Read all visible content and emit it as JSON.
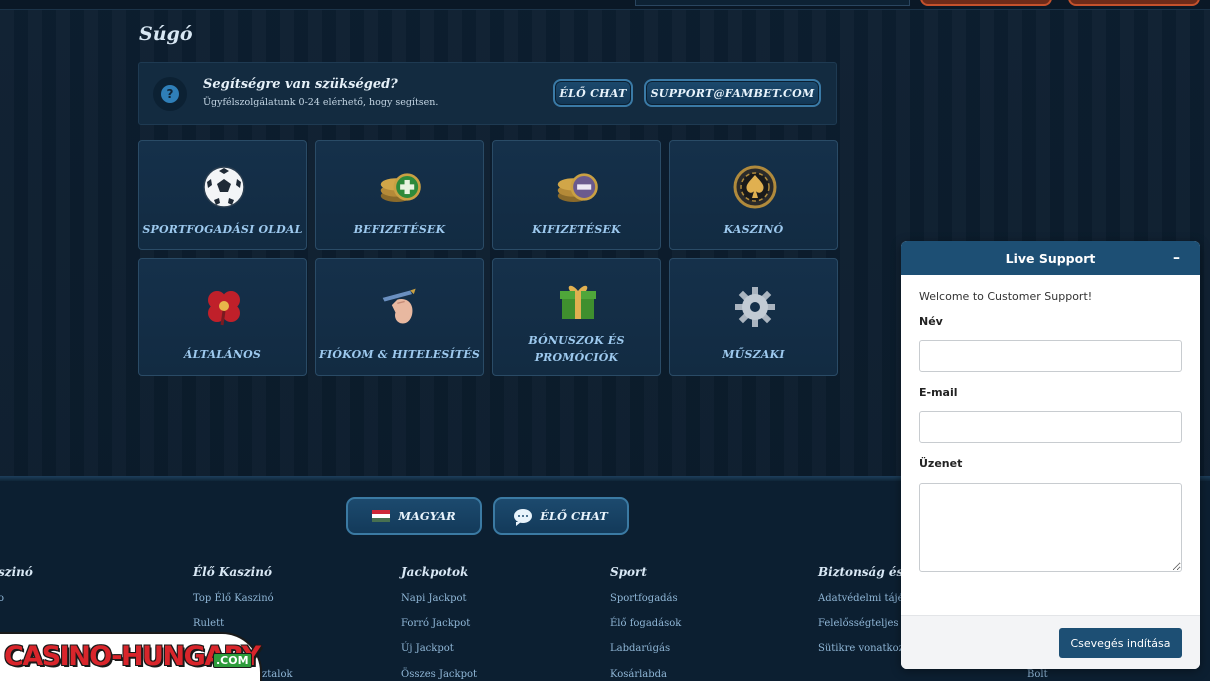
{
  "page": {
    "title": "Súgó"
  },
  "help": {
    "title": "Segítségre van szükséged?",
    "subtitle": "Ügyfélszolgálatunk 0-24 elérhető, hogy segítsen.",
    "live_chat_label": "ÉLŐ CHAT",
    "email_label": "SUPPORT@FAMBET.COM"
  },
  "categories": [
    {
      "label": "SPORTFOGADÁSI OLDAL",
      "icon": "soccer-ball-icon"
    },
    {
      "label": "BEFIZETÉSEK",
      "icon": "coins-plus-icon"
    },
    {
      "label": "KIFIZETÉSEK",
      "icon": "coins-minus-icon"
    },
    {
      "label": "KASZINÓ",
      "icon": "spade-chip-icon"
    },
    {
      "label": "ÁLTALÁNOS",
      "icon": "four-leaf-clover-icon"
    },
    {
      "label": "FIÓKOM & HITELESÍTÉS",
      "icon": "hand-pen-icon"
    },
    {
      "label": "BÓNUSZOK ÉS PROMÓCIÓK",
      "icon": "gift-box-icon"
    },
    {
      "label": "MŰSZAKI",
      "icon": "gear-icon"
    }
  ],
  "footer": {
    "language_label": "MAGYAR",
    "live_chat_label": "ÉLŐ CHAT",
    "columns": [
      {
        "title": "szinó",
        "links": [
          "o"
        ]
      },
      {
        "title": "Élő Kaszinó",
        "links": [
          "Top Élő Kaszinó",
          "Rulett",
          "",
          "ztalok"
        ]
      },
      {
        "title": "Jackpotok",
        "links": [
          "Napi Jackpot",
          "Forró Jackpot",
          "Új Jackpot",
          "Összes Jackpot"
        ]
      },
      {
        "title": "Sport",
        "links": [
          "Sportfogadás",
          "Élő fogadások",
          "Labdarúgás",
          "Kosárlabda"
        ]
      },
      {
        "title": "Biztonság és a",
        "links": [
          "Adatvédelmi tájé",
          "Felelősségteljes sz",
          "Sütikre vonatkoz"
        ]
      }
    ],
    "extra_link": "Bolt"
  },
  "live_support": {
    "header": "Live Support",
    "minimize": "–",
    "welcome": "Welcome to Customer Support!",
    "name_label": "Név",
    "email_label": "E-mail",
    "message_label": "Üzenet",
    "name_value": "",
    "email_value": "",
    "message_value": "",
    "start_button": "Csevegés indítása"
  },
  "watermark": {
    "text": "CASINO-HUNGARY",
    "suffix": ".COM"
  },
  "colors": {
    "background": "#0d1f30",
    "card": "#15304a",
    "accent_blue": "#1d4f74",
    "link_blue": "#9dc9ee"
  }
}
